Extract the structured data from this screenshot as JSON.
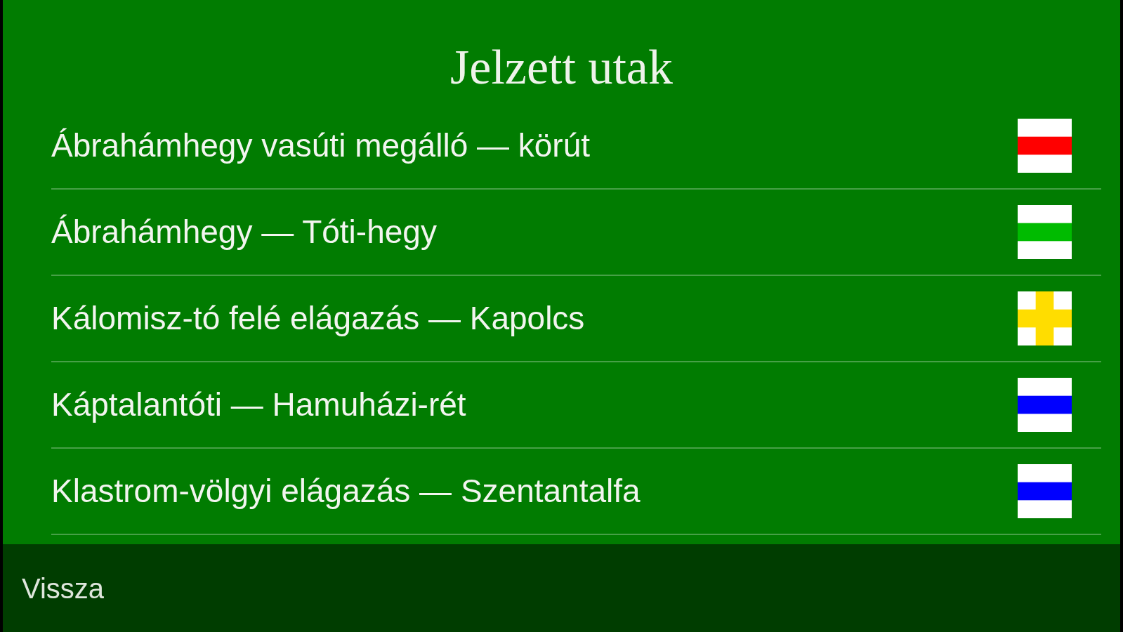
{
  "title": "Jelzett utak",
  "trails": [
    {
      "name": "Ábrahámhegy vasúti megálló — körút",
      "marker": {
        "kind": "stripe",
        "color": "#ff0000"
      }
    },
    {
      "name": "Ábrahámhegy — Tóti-hegy",
      "marker": {
        "kind": "stripe",
        "color": "#00bb00"
      }
    },
    {
      "name": "Kálomisz-tó felé elágazás — Kapolcs",
      "marker": {
        "kind": "cross",
        "color": "#ffdd00"
      }
    },
    {
      "name": "Káptalantóti — Hamuházi-rét",
      "marker": {
        "kind": "stripe",
        "color": "#0000ff"
      }
    },
    {
      "name": "Klastrom-völgyi elágazás — Szentantalfa",
      "marker": {
        "kind": "stripe",
        "color": "#0000ff"
      }
    }
  ],
  "toolbar": {
    "back_button": "Vissza"
  }
}
